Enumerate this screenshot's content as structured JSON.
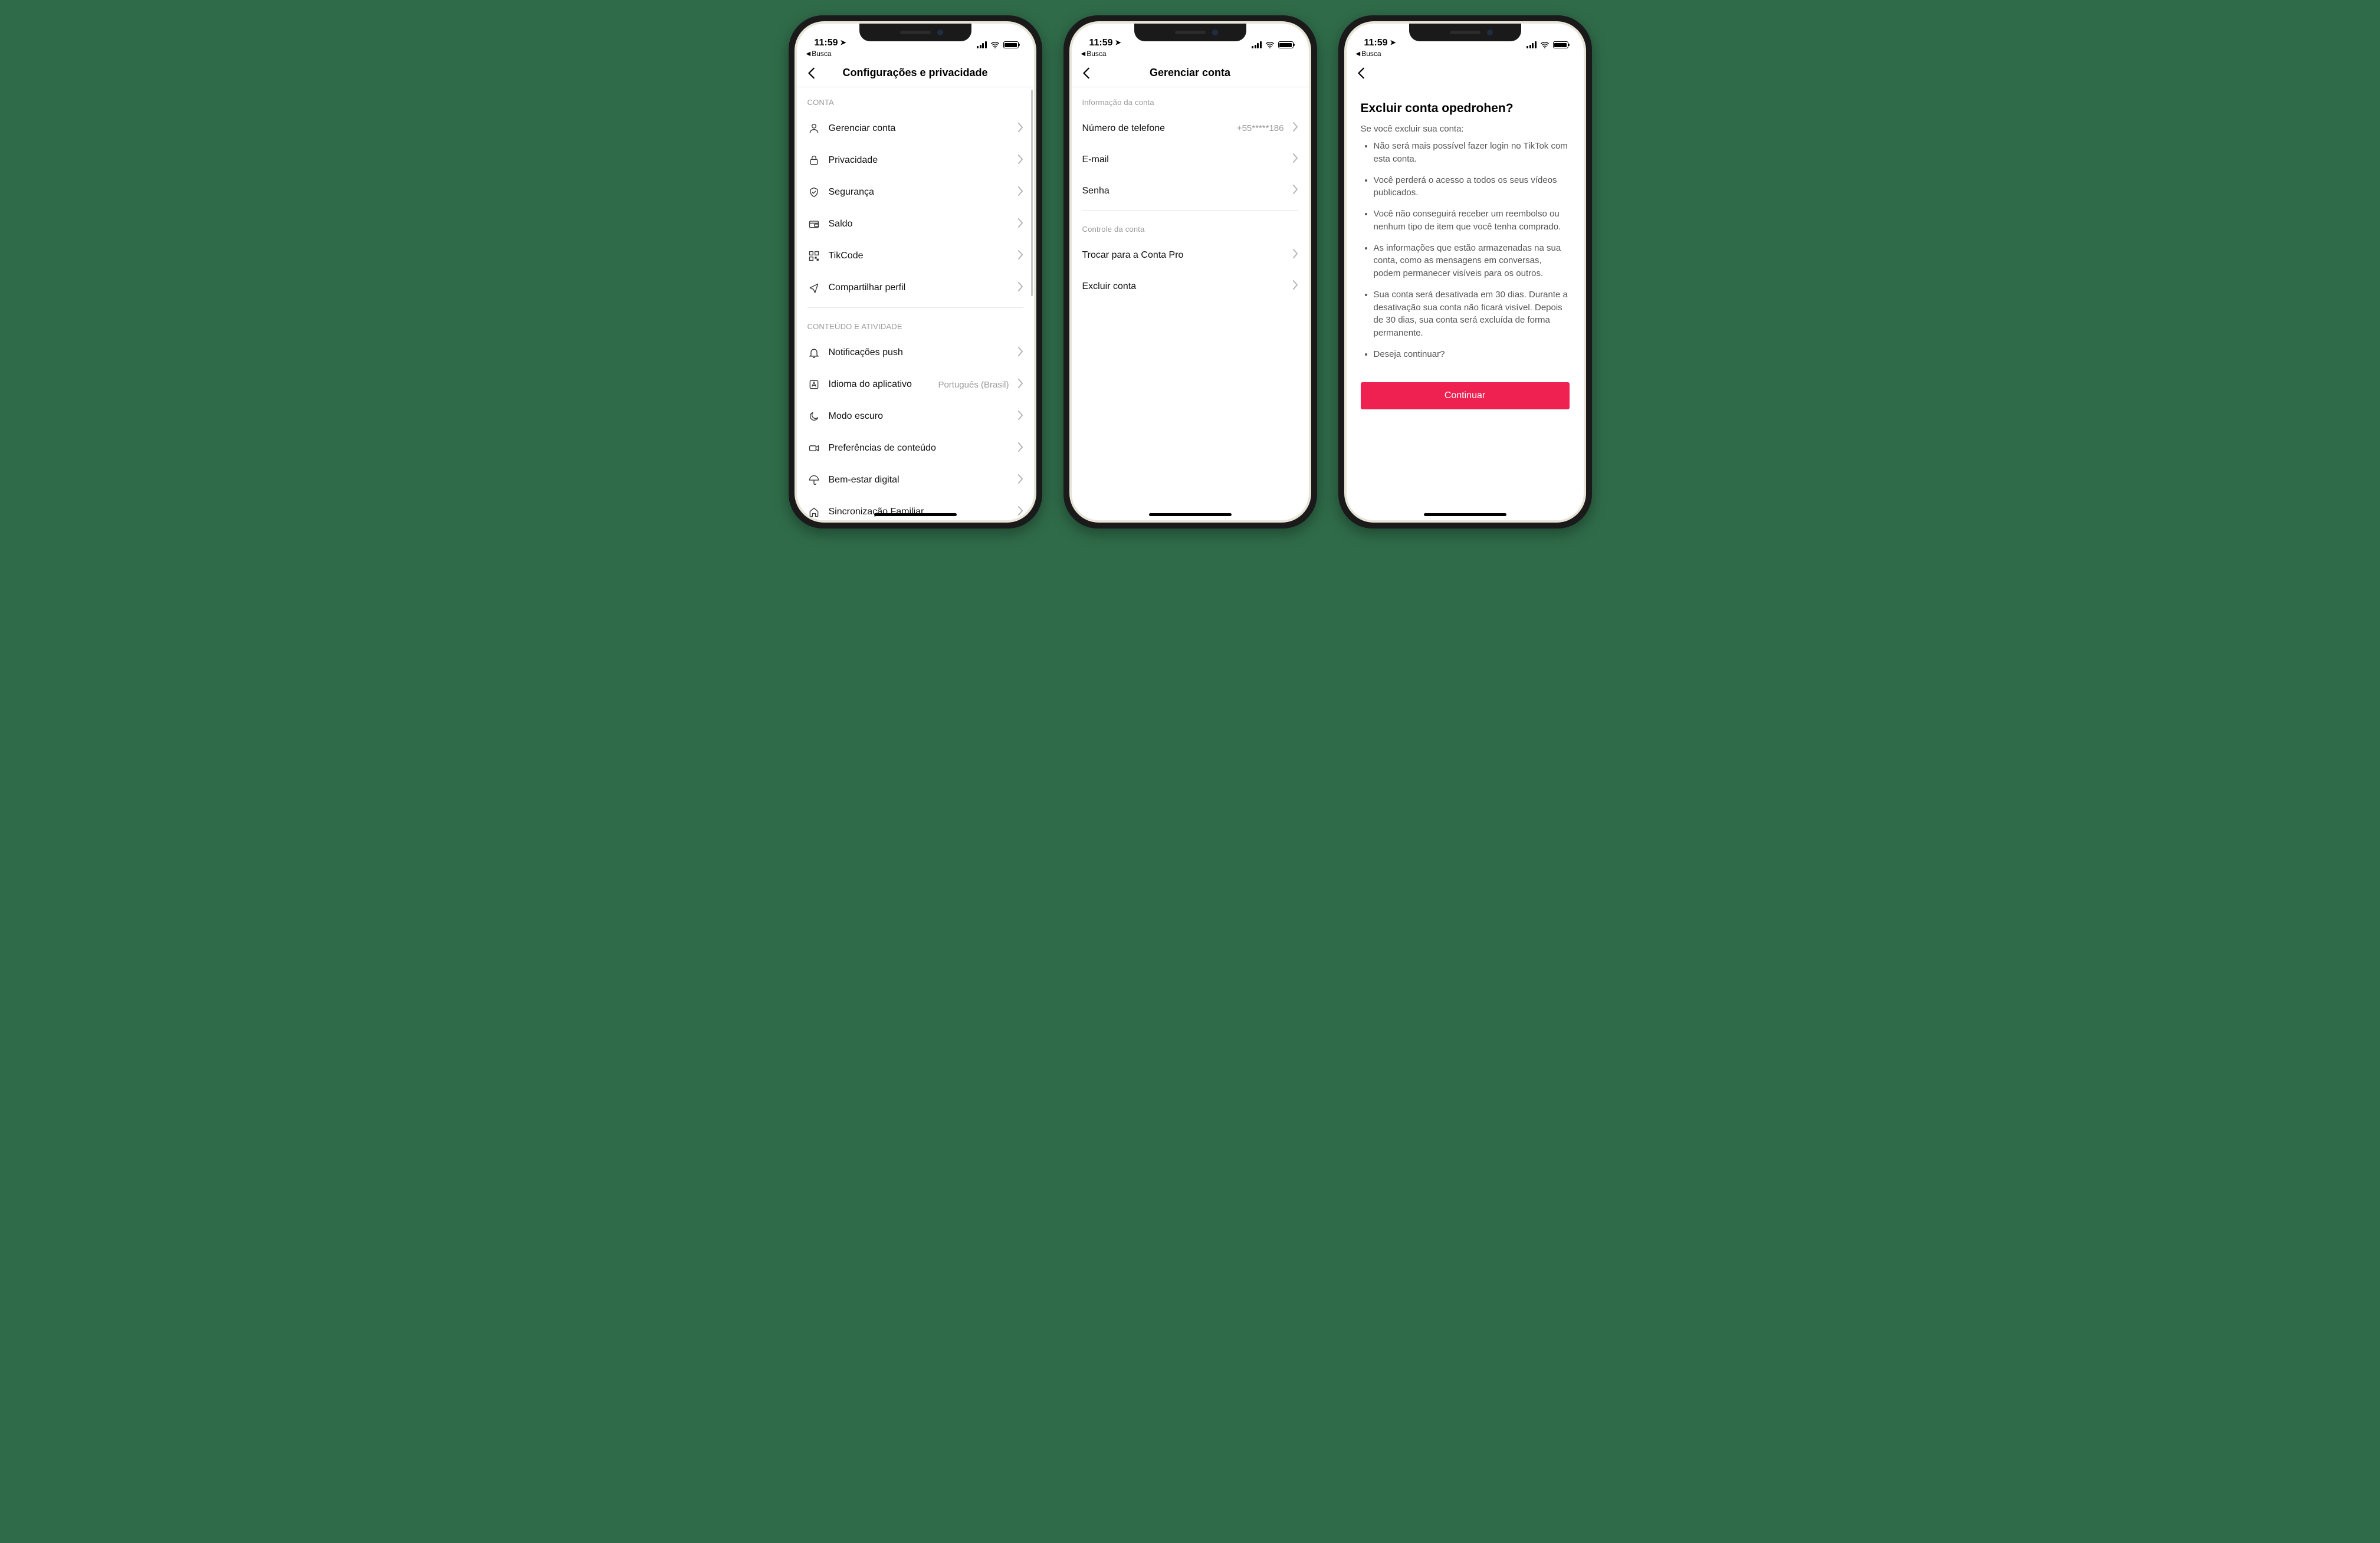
{
  "status": {
    "time": "11:59",
    "back_app": "Busca"
  },
  "screen1": {
    "title": "Configurações e privacidade",
    "section_account": "CONTA",
    "rows_account": [
      {
        "icon": "person",
        "label": "Gerenciar conta"
      },
      {
        "icon": "lock",
        "label": "Privacidade"
      },
      {
        "icon": "shield",
        "label": "Segurança"
      },
      {
        "icon": "wallet",
        "label": "Saldo"
      },
      {
        "icon": "qr",
        "label": "TikCode"
      },
      {
        "icon": "share",
        "label": "Compartilhar perfil"
      }
    ],
    "section_content": "CONTEÚDO E ATIVIDADE",
    "rows_content": [
      {
        "icon": "bell",
        "label": "Notificações push"
      },
      {
        "icon": "lang",
        "label": "Idioma do aplicativo",
        "value": "Português (Brasil)"
      },
      {
        "icon": "moon",
        "label": "Modo escuro"
      },
      {
        "icon": "video",
        "label": "Preferências de conteúdo"
      },
      {
        "icon": "umbrella",
        "label": "Bem-estar digital"
      },
      {
        "icon": "home",
        "label": "Sincronização Familiar"
      }
    ]
  },
  "screen2": {
    "title": "Gerenciar conta",
    "section_info": "Informação da conta",
    "rows_info": [
      {
        "label": "Número de telefone",
        "value": "+55*****186"
      },
      {
        "label": "E-mail"
      },
      {
        "label": "Senha"
      }
    ],
    "section_control": "Controle da conta",
    "rows_control": [
      {
        "label": "Trocar para a Conta Pro"
      },
      {
        "label": "Excluir conta"
      }
    ]
  },
  "screen3": {
    "heading": "Excluir conta opedrohen?",
    "sub": "Se você excluir sua conta:",
    "bullets": [
      "Não será mais possível fazer login no TikTok com esta conta.",
      "Você perderá o acesso a todos os seus vídeos publicados.",
      "Você não conseguirá receber um reembolso ou nenhum tipo de item que você tenha comprado.",
      "As informações que estão armazenadas na sua conta, como as mensagens em conversas, podem permanecer visíveis para os outros.",
      "Sua conta será desativada em 30 dias. Durante a desativação sua conta não ficará visível. Depois de 30 dias, sua conta será excluída de forma permanente.",
      "Deseja continuar?"
    ],
    "cta": "Continuar"
  }
}
